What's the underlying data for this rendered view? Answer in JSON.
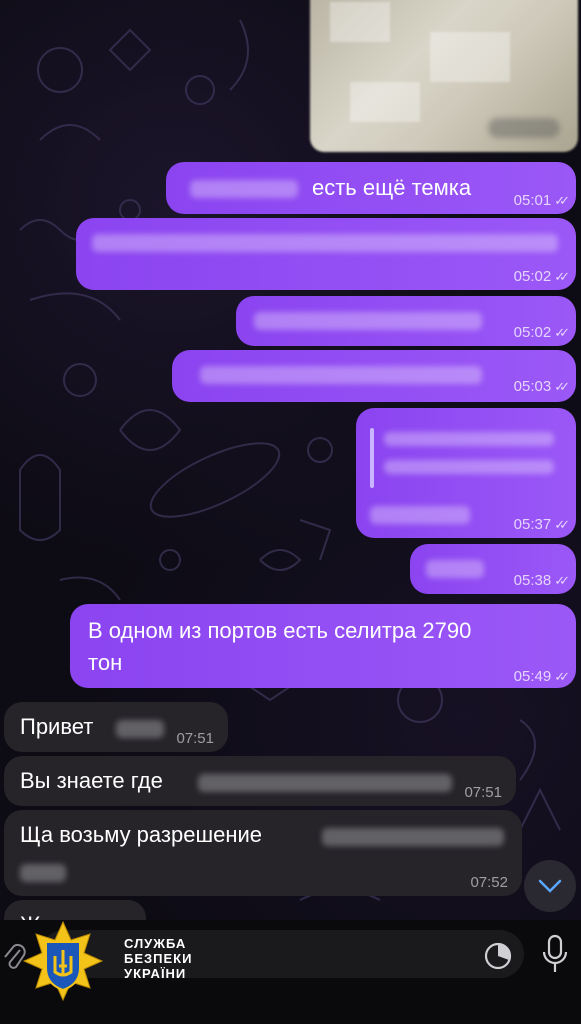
{
  "colors": {
    "outgoing_bubble": "#9150f4",
    "incoming_bubble": "#262429",
    "background": "#0d0b14",
    "ticks": "#ffffff"
  },
  "messages": [
    {
      "id": "m1",
      "direction": "out",
      "text": "есть ещё темка",
      "time": "05:01",
      "status": "read"
    },
    {
      "id": "m2",
      "direction": "out",
      "text": "",
      "time": "05:02",
      "status": "read"
    },
    {
      "id": "m3",
      "direction": "out",
      "text": "",
      "time": "05:02",
      "status": "read"
    },
    {
      "id": "m4",
      "direction": "out",
      "text": "",
      "time": "05:03",
      "status": "read"
    },
    {
      "id": "m5",
      "direction": "out",
      "text": "",
      "time": "05:37",
      "status": "read"
    },
    {
      "id": "m6",
      "direction": "out",
      "text": "",
      "time": "05:38",
      "status": "read"
    },
    {
      "id": "m7",
      "direction": "out",
      "text_line1": "В одном из портов есть селитра 2790",
      "text_line2": "тон",
      "time": "05:49",
      "status": "read"
    },
    {
      "id": "m8",
      "direction": "in",
      "text": "Привет",
      "time": "07:51"
    },
    {
      "id": "m9",
      "direction": "in",
      "text": "Вы знаете где",
      "time": "07:51"
    },
    {
      "id": "m10",
      "direction": "in",
      "text": "Ща возьму разрешение",
      "time": "07:52"
    },
    {
      "id": "m11",
      "direction": "in",
      "text": "Жди"
    }
  ],
  "watermark": {
    "line1": "СЛУЖБА",
    "line2": "БЕЗПЕКИ",
    "line3": "УКРАЇНИ"
  },
  "icons": {
    "scroll_down": "chevron-down-icon",
    "attach": "paperclip-icon",
    "timer": "timer-icon",
    "mic": "microphone-icon"
  }
}
